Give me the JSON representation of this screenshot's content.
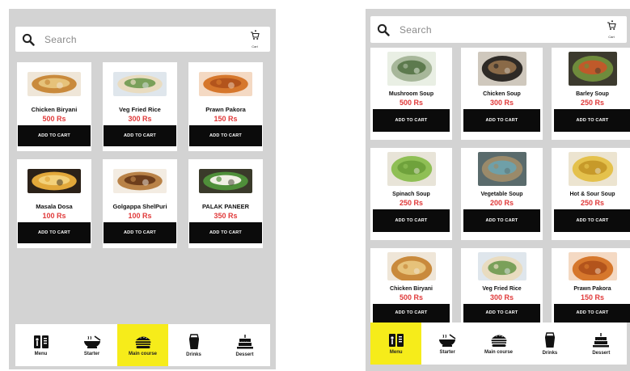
{
  "left_screen": {
    "search": {
      "placeholder": "Search"
    },
    "cart": {
      "label": "Cart"
    },
    "items": [
      {
        "name": "Chicken Biryani",
        "price": "500 Rs",
        "button": "ADD TO CART",
        "image": "biryani-photo"
      },
      {
        "name": "Veg Fried Rice",
        "price": "300 Rs",
        "button": "ADD TO CART",
        "image": "fried-rice-photo"
      },
      {
        "name": "Prawn Pakora",
        "price": "150 Rs",
        "button": "ADD TO CART",
        "image": "pakora-photo"
      },
      {
        "name": "Masala Dosa",
        "price": "100 Rs",
        "button": "ADD TO CART",
        "image": "dosa-photo"
      },
      {
        "name": "Golgappa ShelPuri",
        "price": "100 Rs",
        "button": "ADD TO CART",
        "image": "golgappa-photo"
      },
      {
        "name": "PALAK PANEER",
        "price": "350 Rs",
        "button": "ADD TO CART",
        "image": "palak-paneer-photo"
      }
    ],
    "nav": [
      {
        "label": "Menu",
        "icon": "menu-book-icon",
        "active": false
      },
      {
        "label": "Starter",
        "icon": "soup-bowl-icon",
        "active": false
      },
      {
        "label": "Main course",
        "icon": "burger-icon",
        "active": true
      },
      {
        "label": "Drinks",
        "icon": "cup-icon",
        "active": false
      },
      {
        "label": "Dessert",
        "icon": "cake-icon",
        "active": false
      }
    ]
  },
  "right_screen": {
    "search": {
      "placeholder": "Search"
    },
    "cart": {
      "label": "Cart"
    },
    "items": [
      {
        "name": "Mushroom Soup",
        "price": "500 Rs",
        "button": "ADD TO CART",
        "image": "mushroom-soup-photo"
      },
      {
        "name": "Chicken Soup",
        "price": "300 Rs",
        "button": "ADD TO CART",
        "image": "chicken-soup-photo"
      },
      {
        "name": "Barley Soup",
        "price": "250 Rs",
        "button": "ADD TO CART",
        "image": "barley-soup-photo"
      },
      {
        "name": "Spinach Soup",
        "price": "250 Rs",
        "button": "ADD TO CART",
        "image": "spinach-soup-photo"
      },
      {
        "name": "Vegetable Soup",
        "price": "200 Rs",
        "button": "ADD TO CART",
        "image": "vegetable-soup-photo"
      },
      {
        "name": "Hot & Sour Soup",
        "price": "250 Rs",
        "button": "ADD TO CART",
        "image": "hot-sour-soup-photo"
      },
      {
        "name": "Chicken Biryani",
        "price": "500 Rs",
        "button": "ADD TO CART",
        "image": "biryani-photo"
      },
      {
        "name": "Veg Fried Rice",
        "price": "300 Rs",
        "button": "ADD TO CART",
        "image": "fried-rice-photo"
      },
      {
        "name": "Prawn Pakora",
        "price": "150 Rs",
        "button": "ADD TO CART",
        "image": "pakora-photo"
      }
    ],
    "nav": [
      {
        "label": "Menu",
        "icon": "menu-book-icon",
        "active": true
      },
      {
        "label": "Starter",
        "icon": "soup-bowl-icon",
        "active": false
      },
      {
        "label": "Main course",
        "icon": "burger-icon",
        "active": false
      },
      {
        "label": "Drinks",
        "icon": "cup-icon",
        "active": false
      },
      {
        "label": "Dessert",
        "icon": "cake-icon",
        "active": false
      }
    ]
  },
  "colors": {
    "background": "#d3d3d3",
    "price": "#e03a3a",
    "button": "#0b0b0b",
    "active_nav": "#f6ec1a"
  }
}
